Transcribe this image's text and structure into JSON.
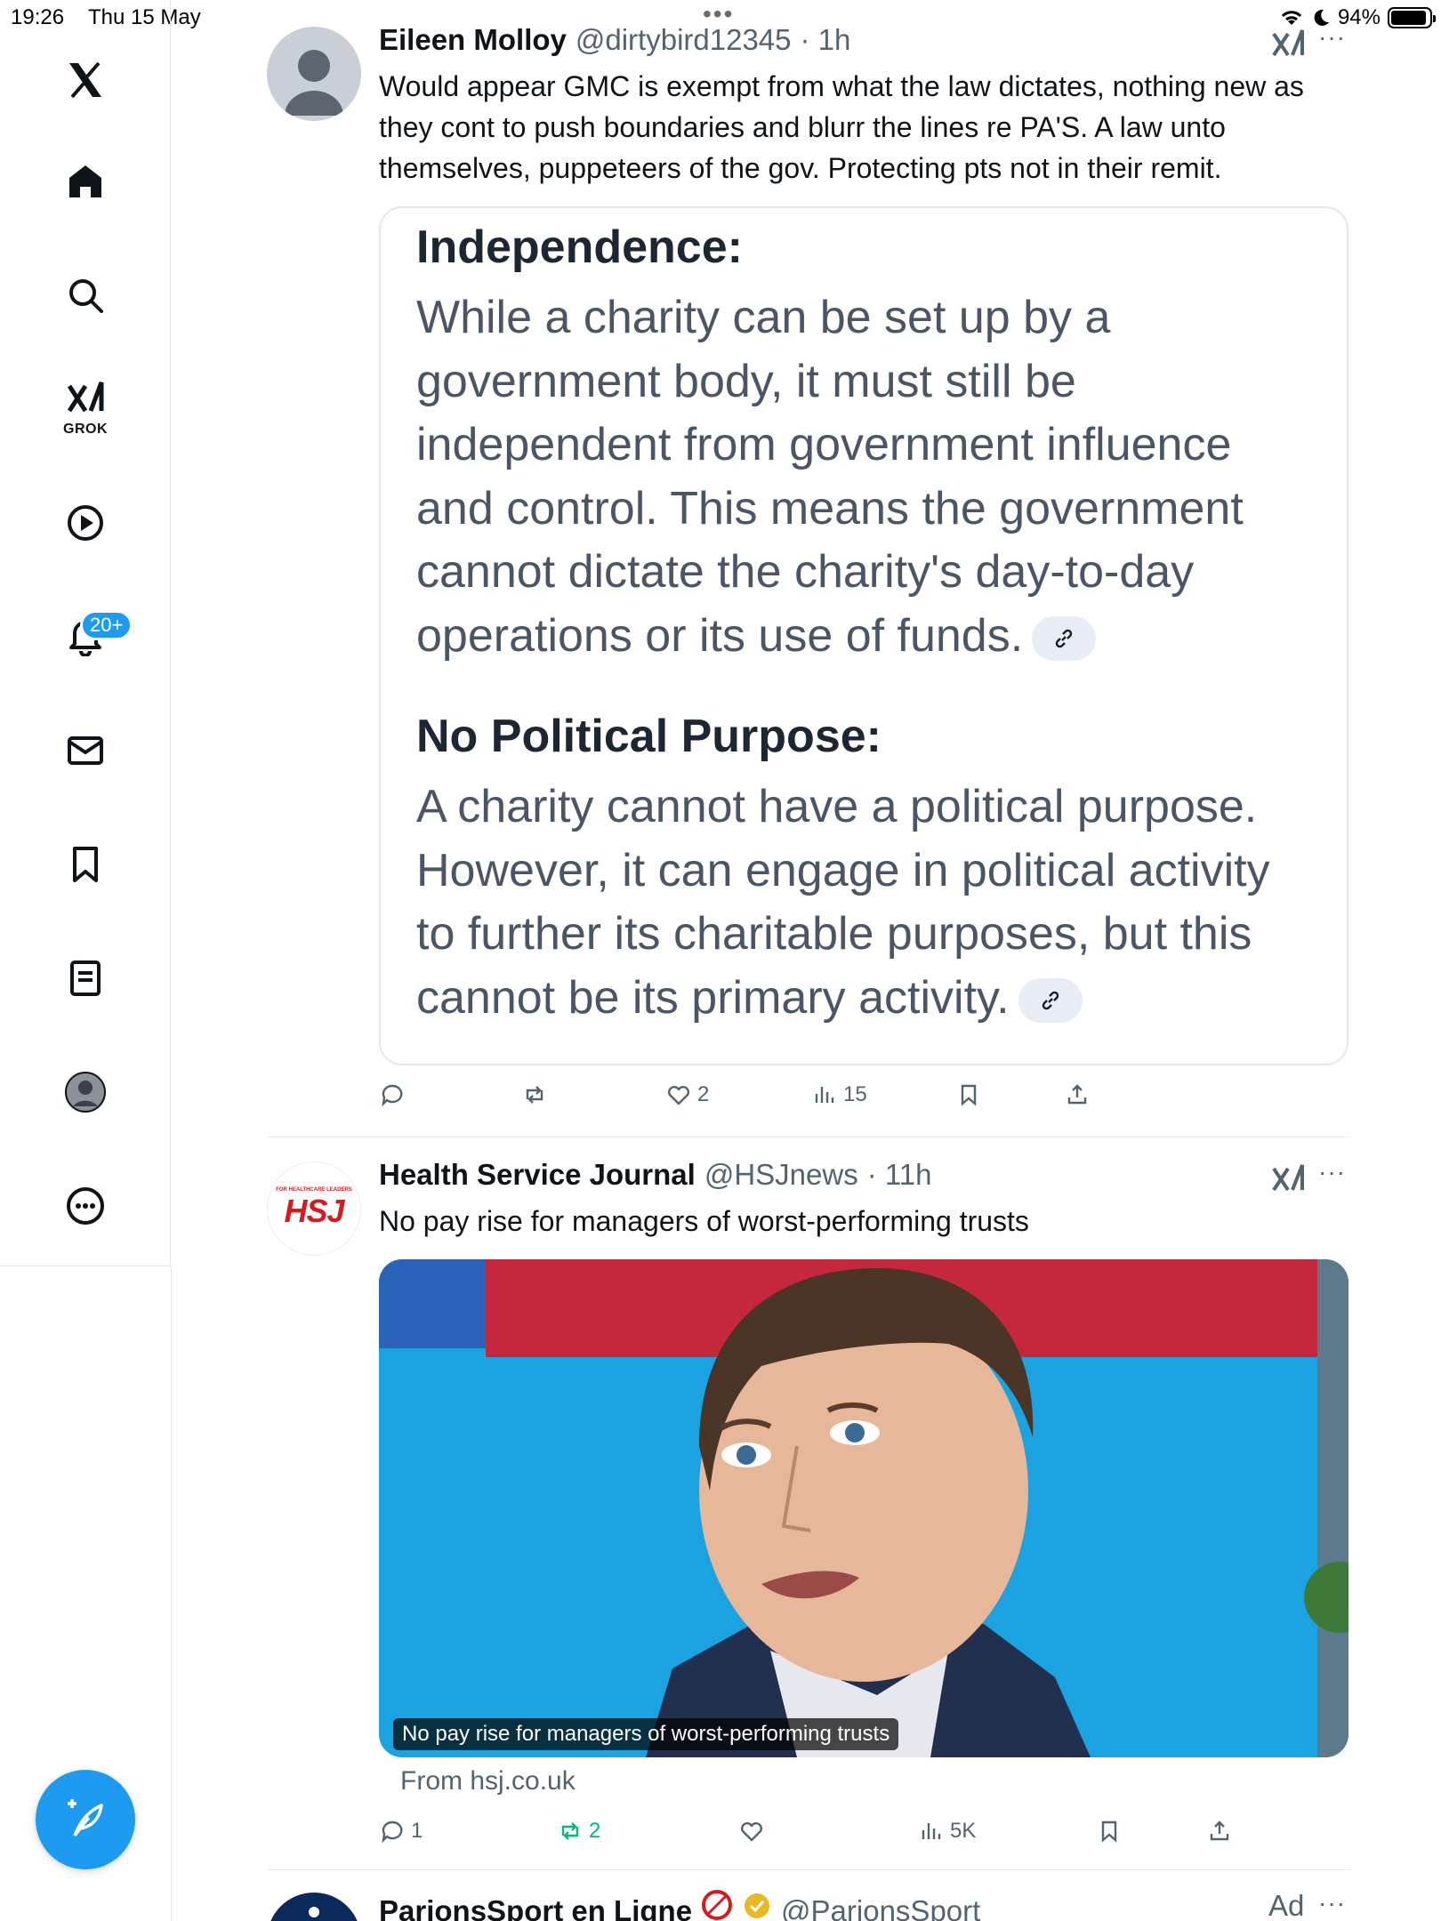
{
  "status_bar": {
    "time": "19:26",
    "date": "Thu 15 May",
    "battery_pct": "94%",
    "battery_level": 0.94,
    "dots": "•••"
  },
  "sidebar": {
    "items": [
      {
        "name": "x-logo",
        "label": ""
      },
      {
        "name": "home",
        "label": ""
      },
      {
        "name": "search",
        "label": ""
      },
      {
        "name": "grok",
        "label": "GROK"
      },
      {
        "name": "video",
        "label": ""
      },
      {
        "name": "notifications",
        "label": "",
        "badge": "20+"
      },
      {
        "name": "messages",
        "label": ""
      },
      {
        "name": "bookmarks",
        "label": ""
      },
      {
        "name": "lists",
        "label": ""
      },
      {
        "name": "profile",
        "label": ""
      },
      {
        "name": "more",
        "label": ""
      }
    ]
  },
  "tweets": [
    {
      "name": "Eileen Molloy",
      "handle": "@dirtybird12345",
      "time": "· 1h",
      "more": "···",
      "text": "Would appear GMC is exempt from what the law dictates, nothing new as they cont to push boundaries and blurr the lines re PA'S. A law unto themselves, puppeteers of the gov. Protecting pts not in their remit.",
      "quote": {
        "heading1": "Independence:",
        "body1": "While a charity can be set up by a government body, it must still be independent from government influence and control. This means the government cannot dictate the charity's day-to-day operations or its use of funds.",
        "heading2": "No Political Purpose:",
        "body2": "A charity cannot have a political purpose. However, it can engage in political activity to further its charitable purposes, but this cannot be its primary activity."
      },
      "actions": {
        "replies": "",
        "reposts": "",
        "likes": "2",
        "views": "15"
      }
    },
    {
      "name": "Health Service Journal",
      "handle": "@HSJnews",
      "time": "· 11h",
      "more": "···",
      "avatar_text": "HSJ",
      "avatar_small": "FOR HEALTHCARE LEADERS",
      "text": "No pay rise for managers of worst-performing trusts",
      "media_caption": "No pay rise for managers of worst-performing trusts",
      "from": "From hsj.co.uk",
      "actions": {
        "replies": "1",
        "reposts": "2",
        "likes": "",
        "views": "5K"
      }
    },
    {
      "name": "ParionsSport en Ligne",
      "handle": "@ParionsSport",
      "ad": "Ad",
      "more": "···"
    }
  ],
  "colors": {
    "accent": "#1d9bf0",
    "text": "#0f1419",
    "muted": "#536471",
    "repost_active": "#00ba7c",
    "hsj_red": "#d71920"
  }
}
